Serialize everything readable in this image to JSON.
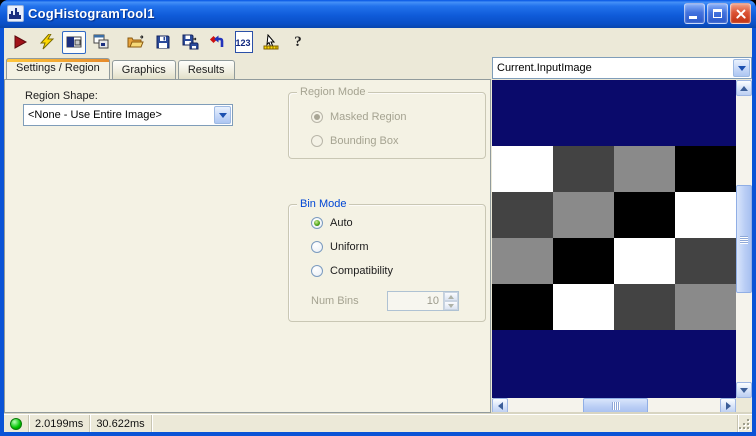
{
  "window": {
    "title": "CogHistogramTool1"
  },
  "toolbar": {
    "icons": [
      "run-icon",
      "electric-run-icon",
      "image-display-toggle-icon",
      "float-display-icon",
      "open-file-icon",
      "save-icon",
      "save-as-icon",
      "reset-icon",
      "results-123-icon",
      "electric-cursor-icon",
      "help-icon"
    ],
    "results_label": "123",
    "help_label": "?"
  },
  "tabs": [
    {
      "label": "Settings / Region",
      "active": true
    },
    {
      "label": "Graphics",
      "active": false
    },
    {
      "label": "Results",
      "active": false
    }
  ],
  "settings": {
    "region_shape_label": "Region Shape:",
    "region_shape_value": "<None - Use Entire Image>",
    "region_mode": {
      "title": "Region Mode",
      "disabled": true,
      "options": [
        {
          "label": "Masked Region",
          "selected": true
        },
        {
          "label": "Bounding Box",
          "selected": false
        }
      ]
    },
    "bin_mode": {
      "title": "Bin Mode",
      "options": [
        {
          "label": "Auto",
          "selected": true
        },
        {
          "label": "Uniform",
          "selected": false
        },
        {
          "label": "Compatibility",
          "selected": false
        }
      ],
      "num_bins_label": "Num Bins",
      "num_bins_value": "10",
      "num_bins_disabled": true
    }
  },
  "image_panel": {
    "source_value": "Current.InputImage",
    "display": {
      "background": "#0A0A6B",
      "checker_colors": {
        "white": "#FFFFFF",
        "dark": "#434343",
        "mid": "#8A8A8A",
        "black": "#000000"
      },
      "grid": [
        [
          "white",
          "dark",
          "mid",
          "black"
        ],
        [
          "dark",
          "mid",
          "black",
          "white"
        ],
        [
          "mid",
          "black",
          "white",
          "dark"
        ],
        [
          "black",
          "white",
          "dark",
          "mid"
        ]
      ]
    }
  },
  "status_bar": {
    "led_color": "#00C400",
    "time1": "2.0199ms",
    "time2": "30.622ms"
  }
}
